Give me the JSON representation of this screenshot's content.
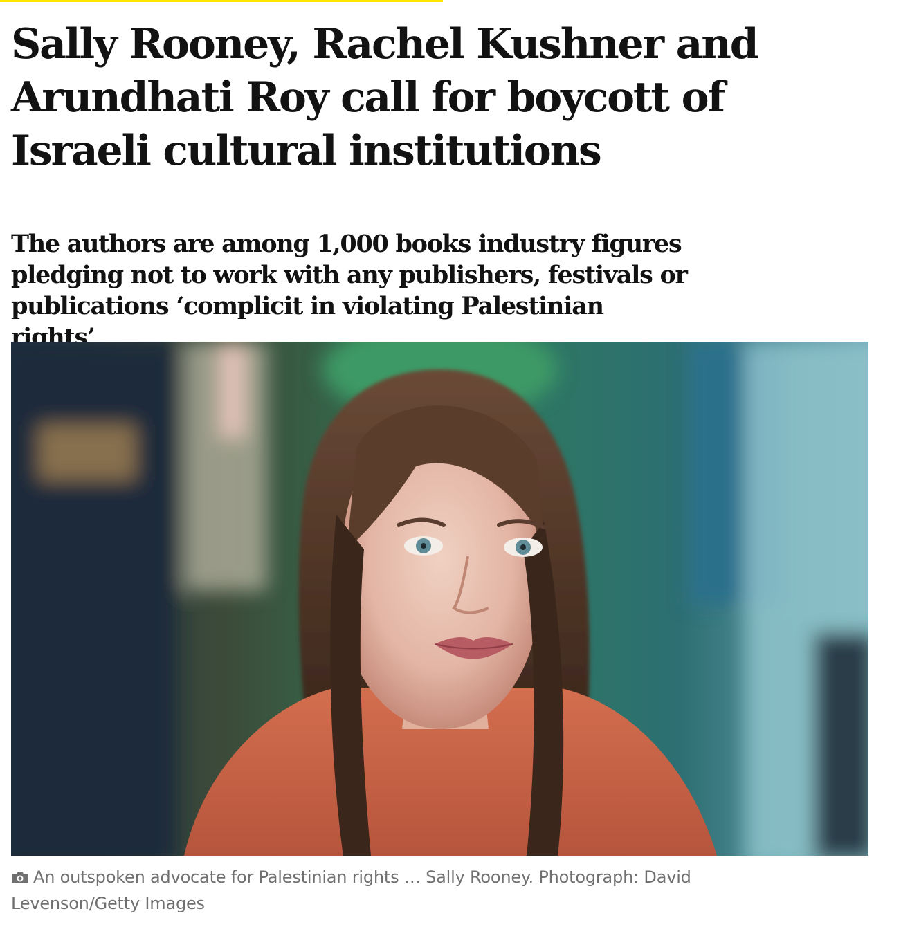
{
  "article": {
    "headline": "Sally Rooney, Rachel Kushner and Arundhati Roy call for boycott of Israeli cultural institutions",
    "standfirst": "The authors are among 1,000 books industry figures pledging not to work with any publishers, festivals or publications ‘complicit in violating Palestinian rights’"
  },
  "image": {
    "caption": "An outspoken advocate for Palestinian rights … Sally Rooney. Photograph: David Levenson/Getty Images",
    "caption_icon": "camera-icon"
  },
  "colors": {
    "accent_rule": "#ffe500",
    "text": "#121212",
    "caption": "#707070"
  }
}
